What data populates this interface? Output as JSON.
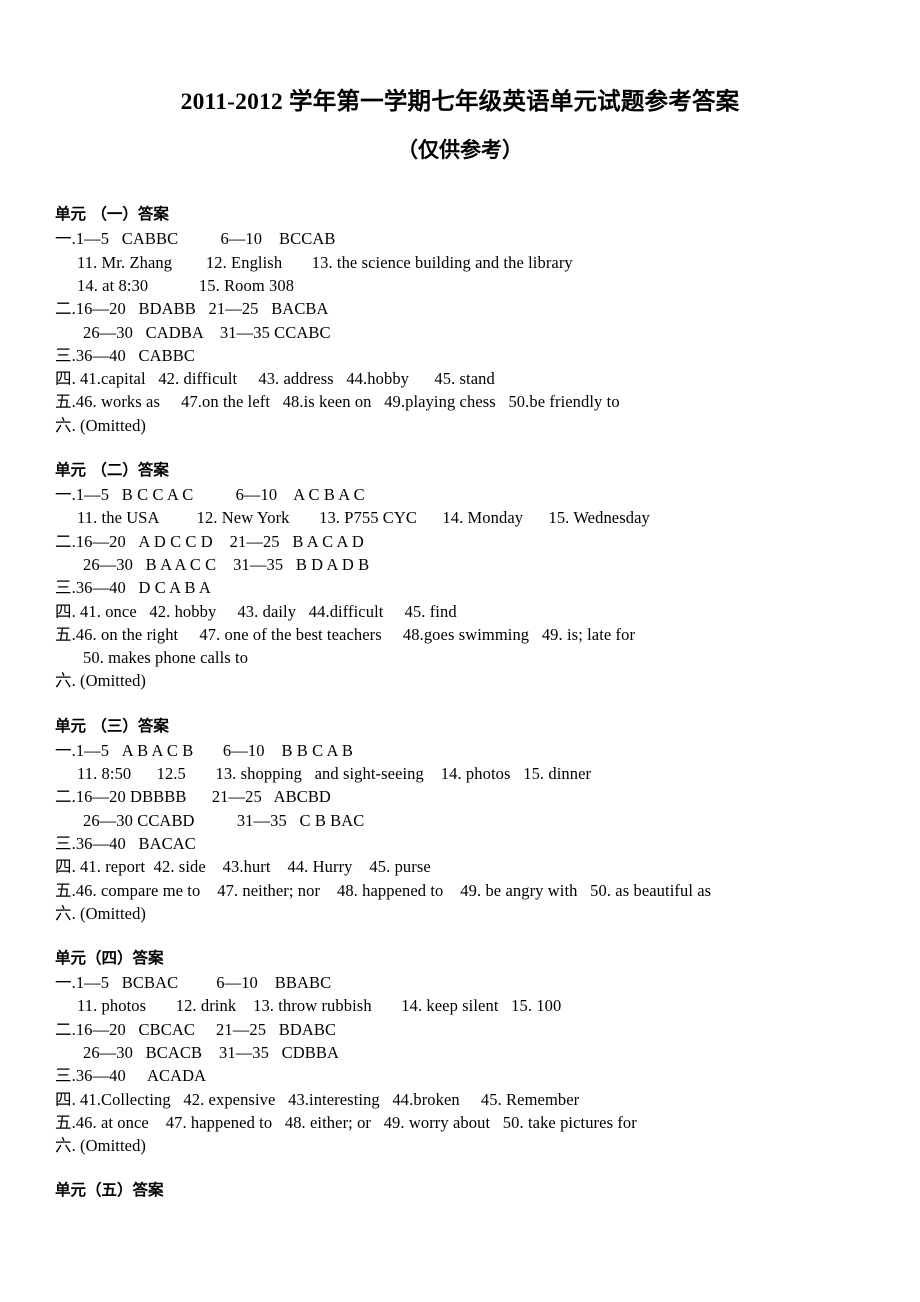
{
  "document": {
    "title": "2011-2012 学年第一学期七年级英语单元试题参考答案",
    "subtitle": "（仅供参考）"
  },
  "units": [
    {
      "heading": "单元 （一）答案",
      "lines": [
        {
          "text": "一.1—5   CABBC          6—10    BCCAB",
          "indent": 0
        },
        {
          "text": "11. Mr. Zhang        12. English       13. the science building and the library",
          "indent": 1
        },
        {
          "text": "14. at 8:30            15. Room 308",
          "indent": 1
        },
        {
          "text": "二.16—20   BDABB   21—25   BACBA",
          "indent": 0
        },
        {
          "text": "26—30   CADBA    31—35 CCABC",
          "indent": 2
        },
        {
          "text": "三.36—40   CABBC",
          "indent": 0
        },
        {
          "text": "四. 41.capital   42. difficult     43. address   44.hobby      45. stand",
          "indent": 0
        },
        {
          "text": "五.46. works as     47.on the left   48.is keen on   49.playing chess   50.be friendly to",
          "indent": 0
        },
        {
          "text": "六. (Omitted)",
          "indent": 0
        }
      ]
    },
    {
      "heading": "单元 （二）答案",
      "lines": [
        {
          "text": "一.1—5   B C C A C          6—10    A C B A C",
          "indent": 0
        },
        {
          "text": "11. the USA         12. New York       13. P755 CYC      14. Monday      15. Wednesday",
          "indent": 1
        },
        {
          "text": "二.16—20   A D C C D    21—25   B A C A D",
          "indent": 0
        },
        {
          "text": "26—30   B A A C C    31—35   B D A D B",
          "indent": 2
        },
        {
          "text": "三.36—40   D C A B A",
          "indent": 0
        },
        {
          "text": "四. 41. once   42. hobby     43. daily   44.difficult     45. find",
          "indent": 0
        },
        {
          "text": "五.46. on the right     47. one of the best teachers     48.goes swimming   49. is; late for",
          "indent": 0
        },
        {
          "text": "50. makes phone calls to",
          "indent": 2
        },
        {
          "text": "六. (Omitted)",
          "indent": 0
        }
      ]
    },
    {
      "heading": "单元 （三）答案",
      "lines": [
        {
          "text": "一.1—5   A B A C B       6—10    B B C A B",
          "indent": 0
        },
        {
          "text": "11. 8:50      12.5       13. shopping   and sight-seeing    14. photos   15. dinner",
          "indent": 1
        },
        {
          "text": "二.16—20 DBBBB      21—25   ABCBD",
          "indent": 0
        },
        {
          "text": "26—30 CCABD          31—35   C B BAC",
          "indent": 2
        },
        {
          "text": "三.36—40   BACAC",
          "indent": 0
        },
        {
          "text": "四. 41. report  42. side    43.hurt    44. Hurry    45. purse",
          "indent": 0
        },
        {
          "text": "五.46. compare me to    47. neither; nor    48. happened to    49. be angry with   50. as beautiful as",
          "indent": 0
        },
        {
          "text": "六. (Omitted)",
          "indent": 0
        }
      ]
    },
    {
      "heading": "单元（四）答案",
      "lines": [
        {
          "text": "一.1—5   BCBAC         6—10    BBABC",
          "indent": 0
        },
        {
          "text": "11. photos       12. drink    13. throw rubbish       14. keep silent   15. 100",
          "indent": 1
        },
        {
          "text": "二.16—20   CBCAC     21—25   BDABC",
          "indent": 0
        },
        {
          "text": "26—30   BCACB    31—35   CDBBA",
          "indent": 2
        },
        {
          "text": "三.36—40     ACADA",
          "indent": 0
        },
        {
          "text": "四. 41.Collecting   42. expensive   43.interesting   44.broken     45. Remember",
          "indent": 0
        },
        {
          "text": "五.46. at once    47. happened to   48. either; or   49. worry about   50. take pictures for",
          "indent": 0
        },
        {
          "text": "六. (Omitted)",
          "indent": 0
        }
      ]
    },
    {
      "heading": "单元（五）答案",
      "lines": []
    }
  ]
}
